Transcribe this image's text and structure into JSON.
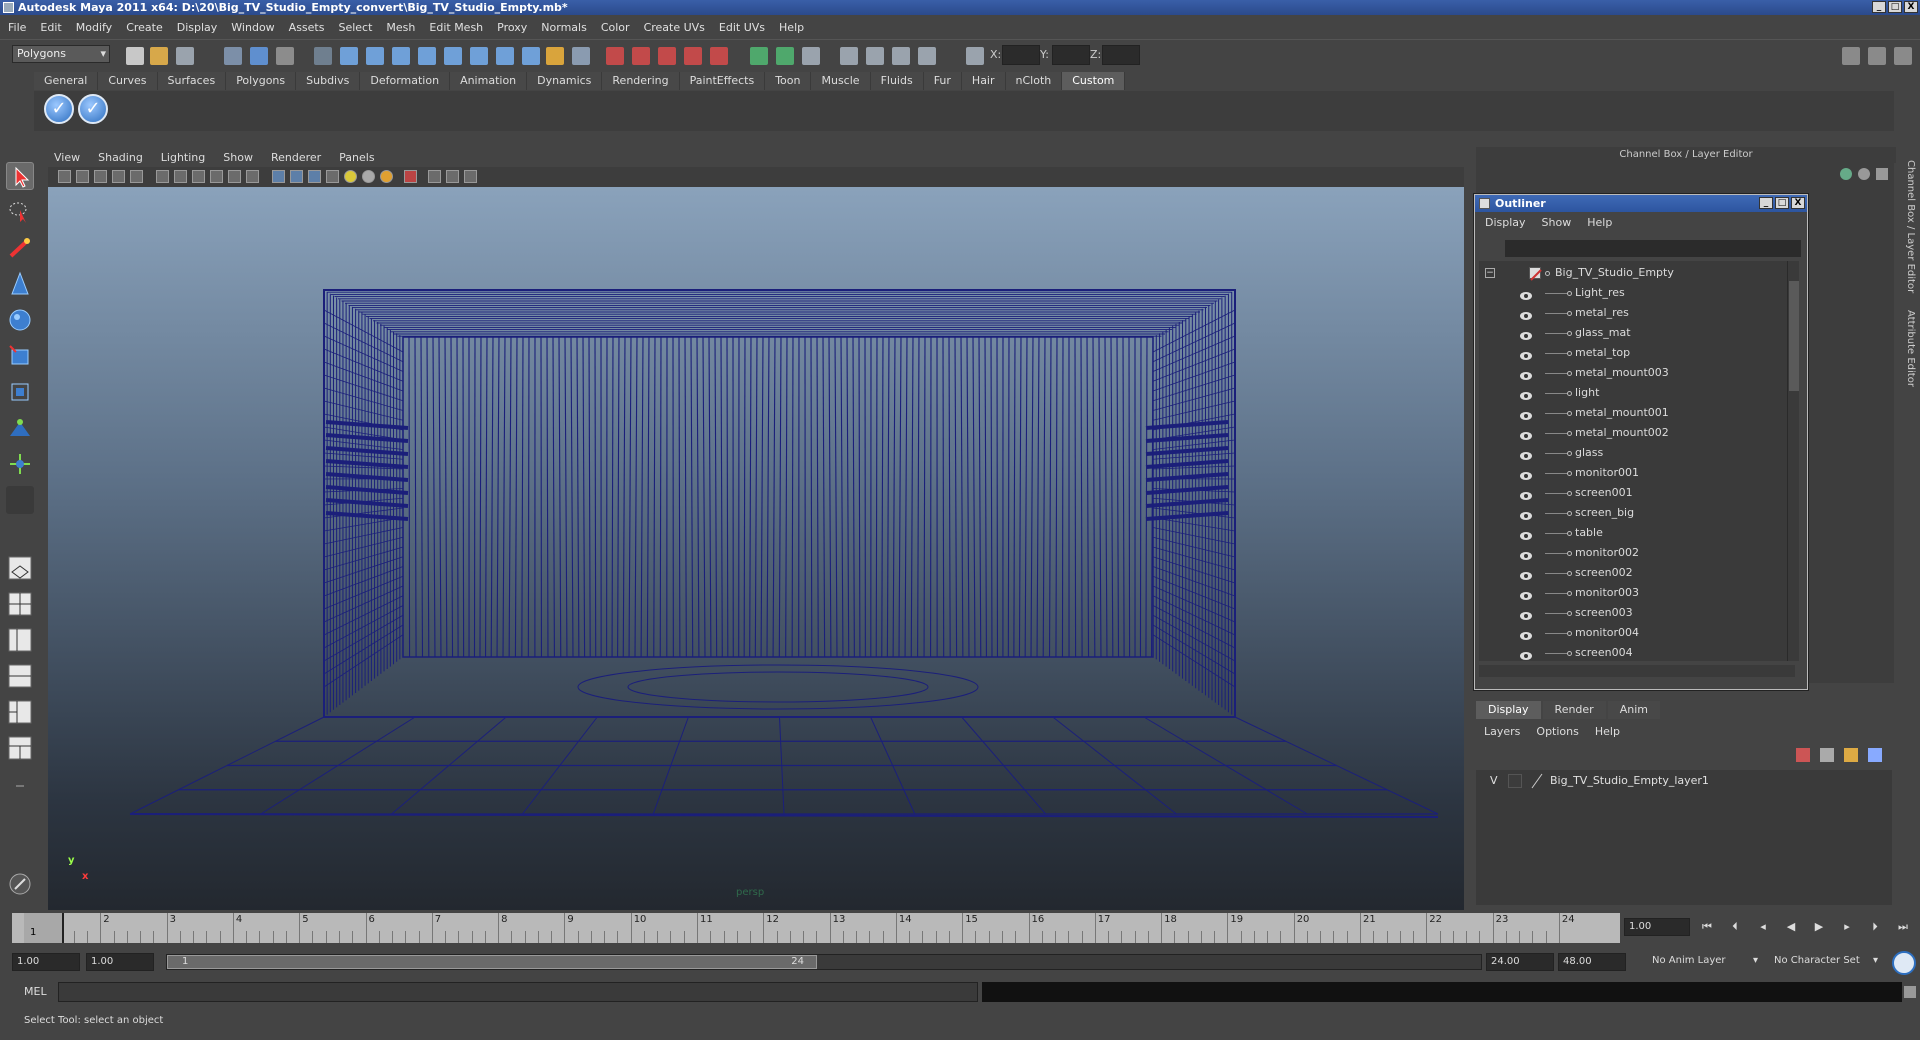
{
  "window": {
    "title": "Autodesk Maya 2011 x64: D:\\20\\Big_TV_Studio_Empty_convert\\Big_TV_Studio_Empty.mb*",
    "buttons": [
      "_",
      "□",
      "X"
    ]
  },
  "menubar": [
    "File",
    "Edit",
    "Modify",
    "Create",
    "Display",
    "Window",
    "Assets",
    "Select",
    "Mesh",
    "Edit Mesh",
    "Proxy",
    "Normals",
    "Color",
    "Create UVs",
    "Edit UVs",
    "Help"
  ],
  "statusline": {
    "menu_set": "Polygons",
    "coord_labels": [
      "X:",
      "Y:",
      "Z:"
    ]
  },
  "shelf": {
    "tabs": [
      "General",
      "Curves",
      "Surfaces",
      "Polygons",
      "Subdivs",
      "Deformation",
      "Animation",
      "Dynamics",
      "Rendering",
      "PaintEffects",
      "Toon",
      "Muscle",
      "Fluids",
      "Fur",
      "Hair",
      "nCloth",
      "Custom"
    ],
    "active_tab": "Custom",
    "icons": [
      "check-icon",
      "check-icon"
    ]
  },
  "viewport": {
    "menu": [
      "View",
      "Shading",
      "Lighting",
      "Show",
      "Renderer",
      "Panels"
    ],
    "camera_label": "persp",
    "axis_y": "y",
    "axis_x": "x"
  },
  "right_panel": {
    "header": "Channel Box / Layer Editor",
    "side_tabs": [
      "Channel Box / Layer Editor",
      "Attribute Editor"
    ]
  },
  "outliner": {
    "title": "Outliner",
    "menu": [
      "Display",
      "Show",
      "Help"
    ],
    "root": "Big_TV_Studio_Empty",
    "items": [
      "Light_res",
      "metal_res",
      "glass_mat",
      "metal_top",
      "metal_mount003",
      "light",
      "metal_mount001",
      "metal_mount002",
      "glass",
      "monitor001",
      "screen001",
      "screen_big",
      "table",
      "monitor002",
      "screen002",
      "monitor003",
      "screen003",
      "monitor004",
      "screen004"
    ]
  },
  "layer_editor": {
    "tabs": [
      "Display",
      "Render",
      "Anim"
    ],
    "active_tab": "Display",
    "menu": [
      "Layers",
      "Options",
      "Help"
    ],
    "layer": {
      "visible": "V",
      "name": "Big_TV_Studio_Empty_layer1"
    }
  },
  "timeline": {
    "ticks": [
      "1",
      "2",
      "3",
      "4",
      "5",
      "6",
      "7",
      "8",
      "9",
      "10",
      "11",
      "12",
      "13",
      "14",
      "15",
      "16",
      "17",
      "18",
      "19",
      "20",
      "21",
      "22",
      "23",
      "24"
    ],
    "current_frame_marker": "1",
    "current_frame": "1.00"
  },
  "range": {
    "start": "1.00",
    "playback_start": "1.00",
    "range_start_label": "1",
    "range_end_label": "24",
    "playback_end": "24.00",
    "end": "48.00",
    "anim_layer": "No Anim Layer",
    "character_set": "No Character Set"
  },
  "command_line": {
    "label": "MEL"
  },
  "help_line": "Select Tool: select an object",
  "colors": {
    "wireframe": "#1b1f7a",
    "outliner_title": "#3f6ab6",
    "title_bar": "#2b4a8c"
  }
}
